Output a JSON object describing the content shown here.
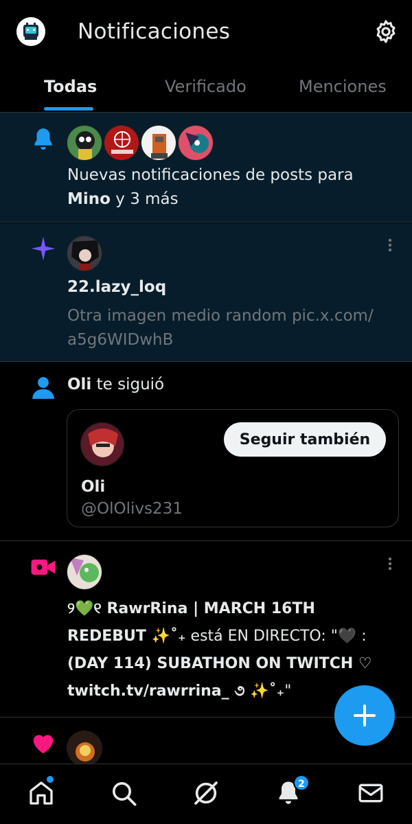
{
  "header": {
    "title": "Notificaciones"
  },
  "tabs": [
    {
      "label": "Todas",
      "active": true
    },
    {
      "label": "Verificado",
      "active": false
    },
    {
      "label": "Menciones",
      "active": false
    }
  ],
  "notifications": [
    {
      "type": "bell",
      "icon": "bell-icon",
      "text_prefix": "Nuevas notificaciones de posts para",
      "name": "Mino",
      "text_suffix": "y 3 más",
      "unread": true
    },
    {
      "type": "spark",
      "icon": "sparkle-icon",
      "username": "22.lazy_loq",
      "post_text_line1": "Otra imagen medio random pic.x.com/",
      "post_text_line2": "a5g6WIDwhB",
      "unread": true
    },
    {
      "type": "follow",
      "icon": "person-icon",
      "name": "Oli",
      "action": "te siguió",
      "card": {
        "button_label": "Seguir también",
        "display_name": "Oli",
        "handle": "@OlOlivs231"
      }
    },
    {
      "type": "live",
      "icon": "video-camera-icon",
      "line1": "୨💚୧ RawrRina | MARCH 16TH",
      "line2_bold": "REDEBUT ✨˚₊",
      "line2_rest": " está EN DIRECTO: \"🖤 :",
      "line3": "(DAY 114) SUBATHON ON TWITCH ♡",
      "line4_bold": "twitch.tv/rawrrina_ ૭ ✨˚₊",
      "line4_rest": "\""
    },
    {
      "type": "like",
      "icon": "heart-icon"
    }
  ],
  "bottom_nav": {
    "items": [
      "home-icon",
      "search-icon",
      "grok-icon",
      "bell-icon",
      "mail-icon"
    ],
    "notification_badge": "2"
  },
  "colors": {
    "accent": "#1d9bf0",
    "unread_bg": "#071d2b",
    "sparkle": "#7856ff",
    "live": "#f91880",
    "like": "#f91880"
  }
}
